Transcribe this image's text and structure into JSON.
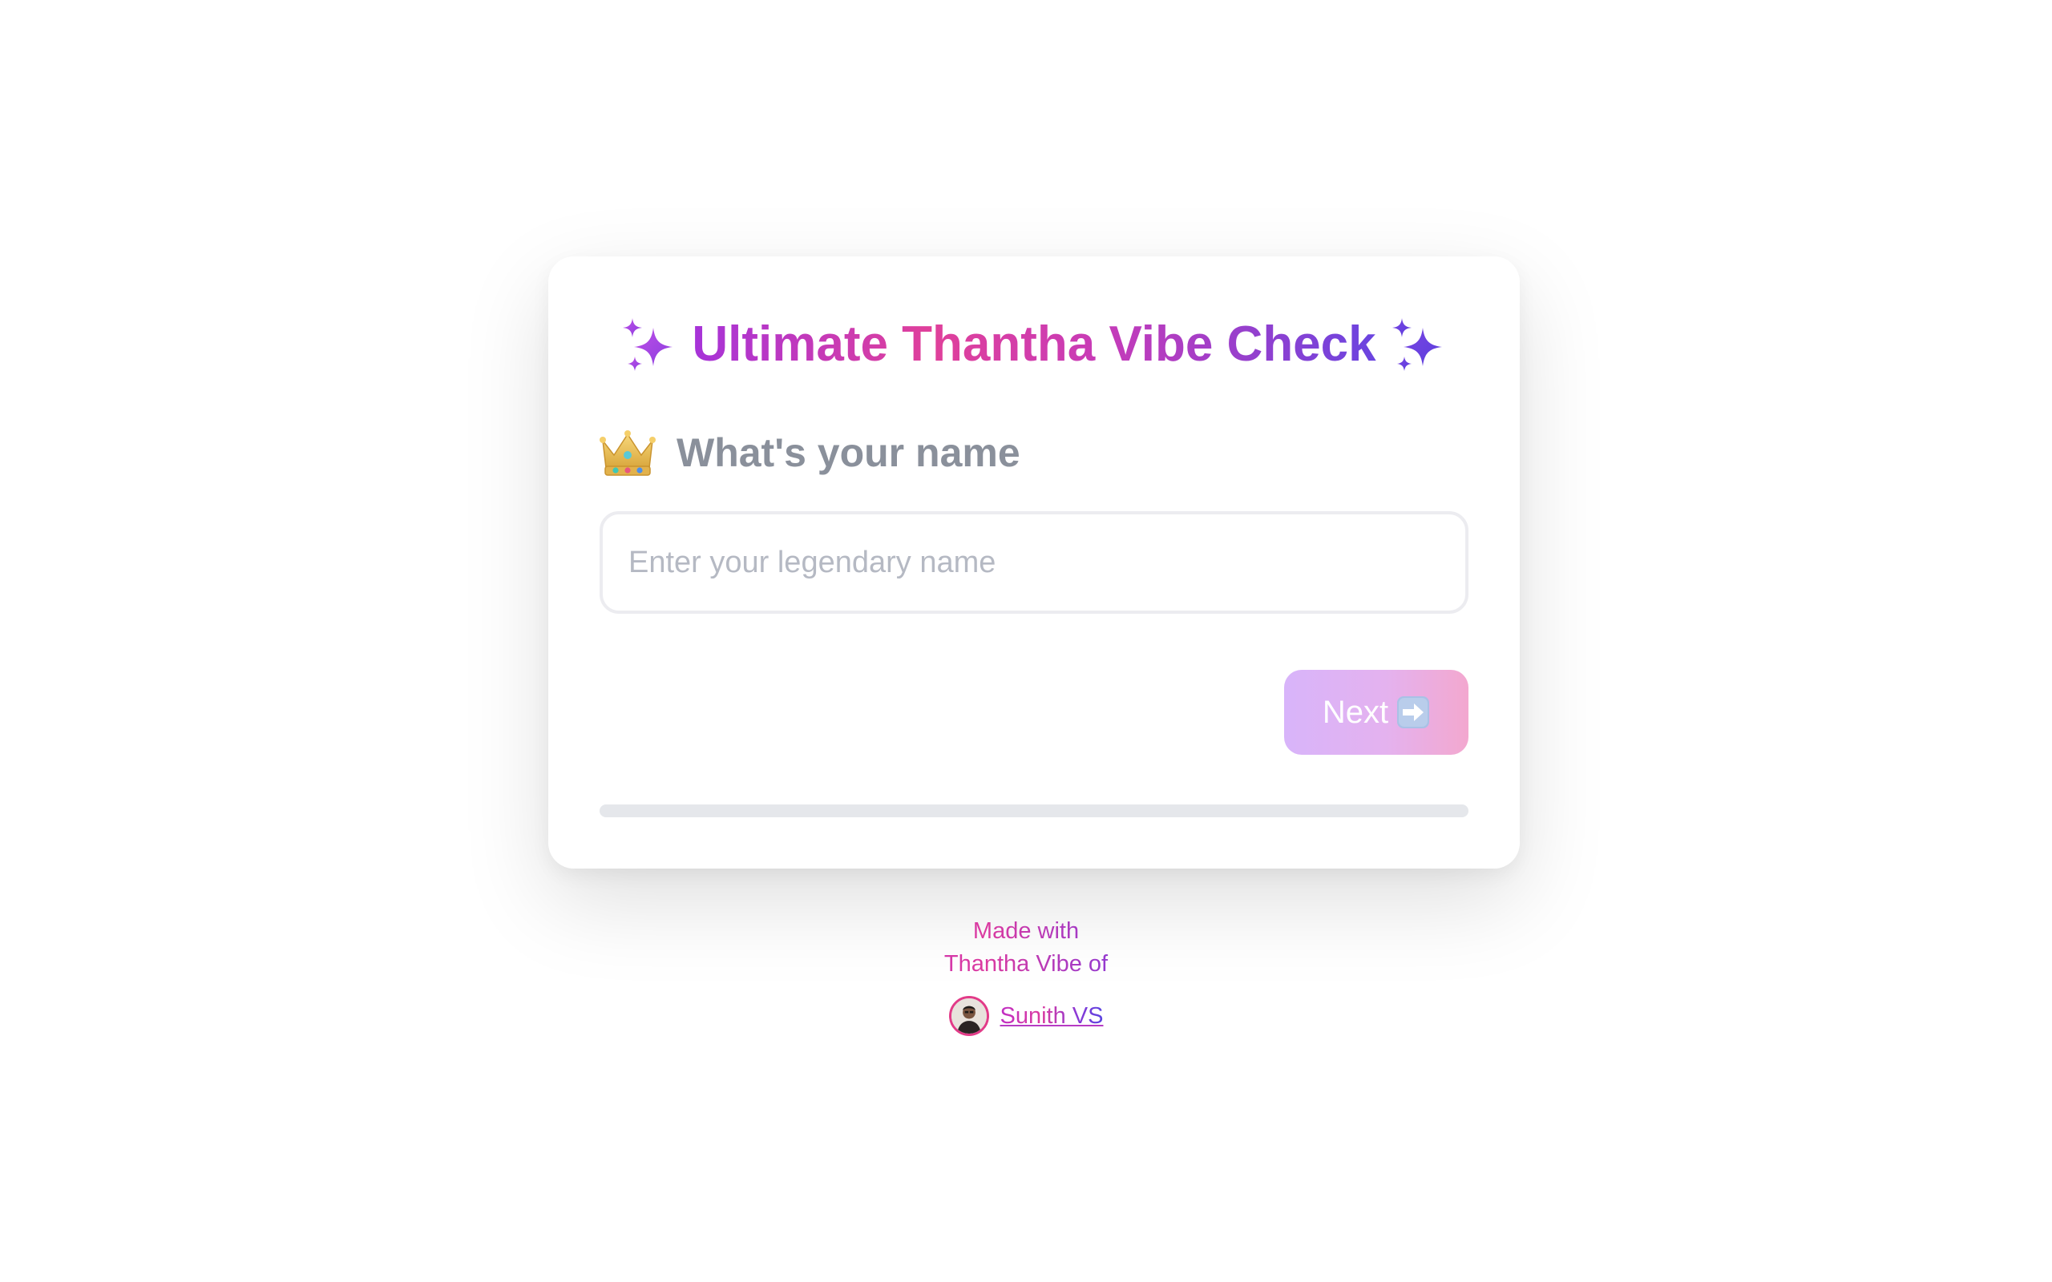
{
  "header": {
    "title": "Ultimate Thantha Vibe Check",
    "sparkle_icon": "sparkles-icon"
  },
  "question": {
    "icon": "crown-icon",
    "text": "What's your name"
  },
  "name_input": {
    "value": "",
    "placeholder": "Enter your legendary name"
  },
  "next_button": {
    "label": "Next",
    "icon": "right-arrow-icon",
    "enabled": false
  },
  "progress": {
    "fraction": 0
  },
  "footer": {
    "line1": "Made with",
    "line2": "Thantha Vibe of",
    "author": "Sunith VS",
    "avatar_icon": "avatar"
  },
  "colors": {
    "brand_purple": "#a633d9",
    "brand_pink": "#e0409a",
    "brand_indigo": "#6a44e0",
    "question_gray": "#8a909b",
    "placeholder_gray": "#b5b9c3",
    "progress_track": "#e5e7eb"
  }
}
